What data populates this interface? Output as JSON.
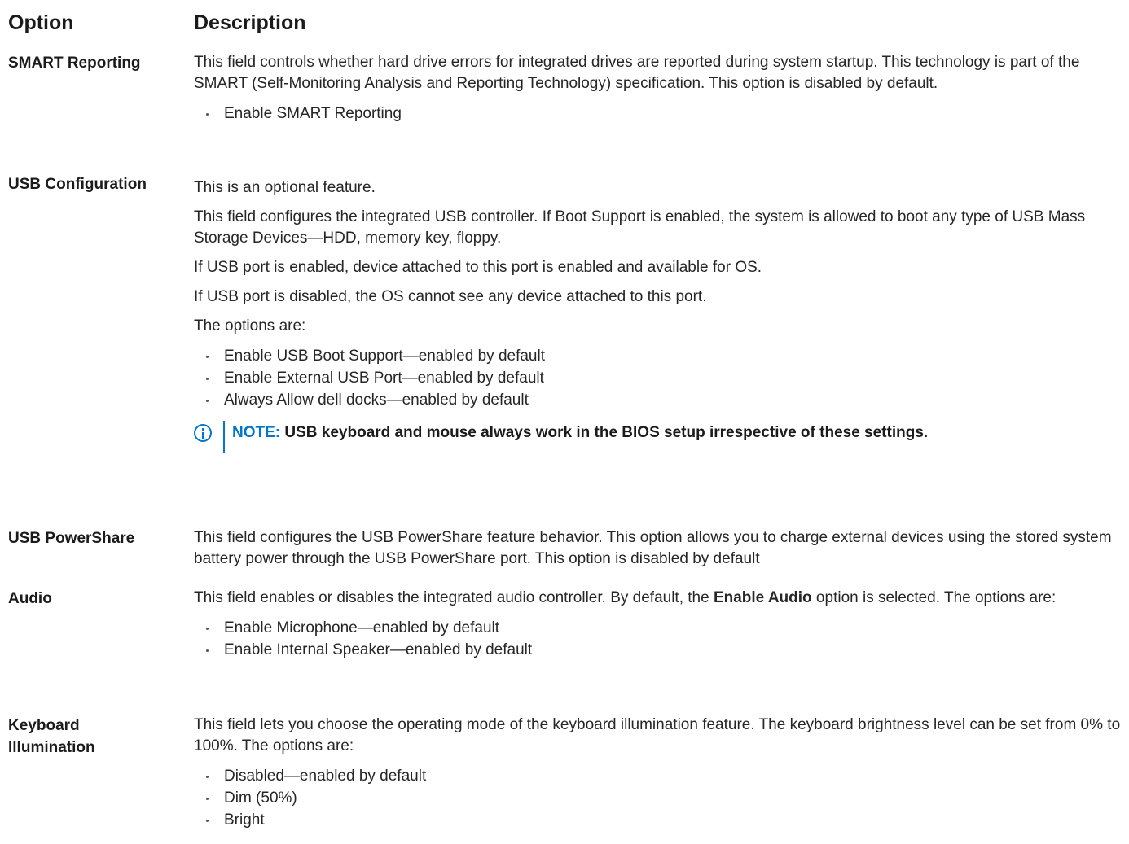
{
  "header": {
    "option": "Option",
    "description": "Description"
  },
  "rows": [
    {
      "option": "SMART Reporting",
      "paragraphs": [
        "This field controls whether hard drive errors for integrated drives are reported during system startup. This technology is part of the SMART (Self-Monitoring Analysis and Reporting Technology) specification. This option is disabled by default."
      ],
      "items": [
        "Enable SMART Reporting"
      ]
    },
    {
      "option": "USB Configuration",
      "paragraphs": [
        "This is an optional feature.",
        "This field configures the integrated USB controller. If Boot Support is enabled, the system is allowed to boot any type of USB Mass Storage Devices—HDD, memory key, floppy.",
        "If USB port is enabled, device attached to this port is enabled and available for OS.",
        "If USB port is disabled, the OS cannot see any device attached to this port.",
        "The options are:"
      ],
      "items": [
        "Enable USB Boot Support—enabled by default",
        "Enable External USB Port—enabled by default",
        "Always Allow dell docks—enabled by default"
      ],
      "note": {
        "label": "NOTE:",
        "text": " USB keyboard and mouse always work in the BIOS setup irrespective of these settings."
      }
    },
    {
      "option": "USB PowerShare",
      "paragraphs": [
        "This field configures the USB PowerShare feature behavior. This option allows you to charge external devices using the stored system battery power through the USB PowerShare port. This option is disabled by default"
      ]
    },
    {
      "option": "Audio",
      "para_pre": "This field enables or disables the integrated audio controller. By default, the ",
      "para_bold": "Enable Audio",
      "para_post": " option is selected. The options are:",
      "items": [
        "Enable Microphone—enabled by default",
        "Enable Internal Speaker—enabled by default"
      ]
    },
    {
      "option_line1": "Keyboard",
      "option_line2": "Illumination",
      "paragraphs": [
        "This field lets you choose the operating mode of the keyboard illumination feature. The keyboard brightness level can be set from 0% to 100%. The options are:"
      ],
      "items": [
        "Disabled—enabled by default",
        "Dim (50%)",
        "Bright"
      ]
    }
  ]
}
